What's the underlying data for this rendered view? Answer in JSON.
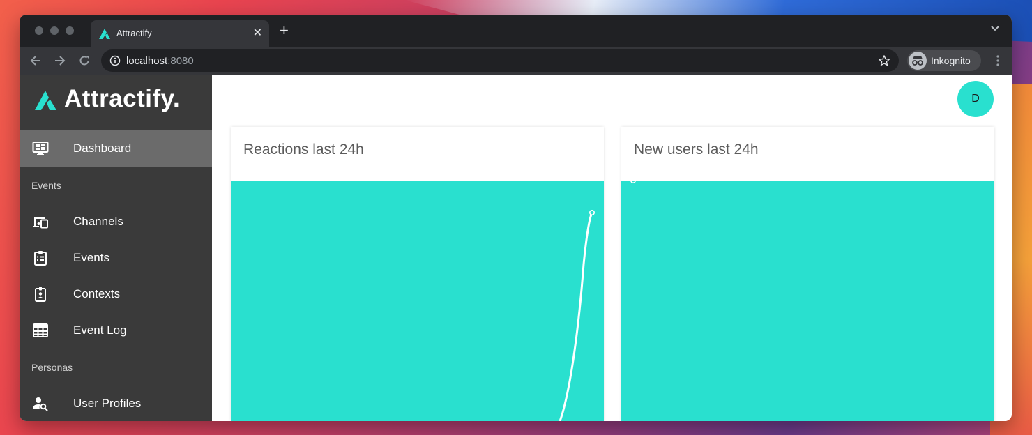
{
  "browser": {
    "tab": {
      "title": "Attractify"
    },
    "address": {
      "host": "localhost",
      "port": ":8080"
    },
    "profile": {
      "label": "Inkognito"
    }
  },
  "sidebar": {
    "logo_text": "Attractify.",
    "items": [
      {
        "label": "Dashboard",
        "icon": "monitor-dashboard-icon",
        "active": true
      },
      {
        "section": "Events"
      },
      {
        "label": "Channels",
        "icon": "devices-icon"
      },
      {
        "label": "Events",
        "icon": "clipboard-list-icon"
      },
      {
        "label": "Contexts",
        "icon": "badge-account-icon"
      },
      {
        "label": "Event Log",
        "icon": "table-grid-icon"
      },
      {
        "section": "Personas"
      },
      {
        "label": "User Profiles",
        "icon": "account-search-icon"
      }
    ]
  },
  "header": {
    "avatar_letter": "D"
  },
  "cards": [
    {
      "title": "Reactions last 24h"
    },
    {
      "title": "New users last 24h"
    }
  ],
  "colors": {
    "accent": "#29e0cf",
    "sidebar_bg": "#3a3a3a",
    "sidebar_active": "#6b6b6b"
  }
}
